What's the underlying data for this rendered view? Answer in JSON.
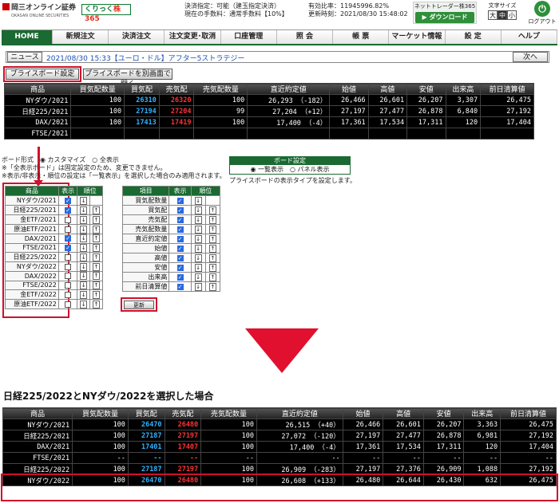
{
  "header": {
    "logo_okasan": "岡三オンライン証券",
    "logo_okasan_sub": "OKASAN ONLINE SECURITIES",
    "logo_kurikku": "くりっく",
    "logo_kabu": "株365",
    "info_left": [
      "決済指定：可能（建玉指定決済）",
      "現在の手数料：通常手数料【10%】"
    ],
    "info_right": [
      "有効比率：11945996.82%",
      "更新時刻：2021/08/30 15:48:02"
    ],
    "net_trader": "ネットトレーダー株365",
    "download_label": "ダウンロード",
    "font_size_label": "文字サイズ",
    "font_sizes": [
      "大",
      "中",
      "小"
    ],
    "logout_label": "ログアウト"
  },
  "nav": [
    "HOME",
    "新規注文",
    "決済注文",
    "注文変更･取消",
    "口座管理",
    "照 会",
    "帳 票",
    "マーケット情報",
    "設 定",
    "ヘルプ"
  ],
  "news": {
    "label": "ニュース",
    "text": "2021/08/30 15:33【ユーロ・ドル】アフター5ストラテジー",
    "next": "次へ"
  },
  "price_board_btn": "プライスボード設定",
  "price_board_open_btn": "プライスボードを別画面で開く",
  "quote_headers": [
    "商品",
    "買気配数量",
    "買気配",
    "売気配",
    "売気配数量",
    "直近約定値",
    "始値",
    "高値",
    "安値",
    "出来高",
    "前日清算値"
  ],
  "quotes_top": [
    [
      "NYダウ/2021",
      "100",
      "26310",
      "26320",
      "100",
      "26,293 （-182）",
      "26,466",
      "26,601",
      "26,207",
      "3,307",
      "26,475"
    ],
    [
      "日経225/2021",
      "100",
      "27194",
      "27204",
      "99",
      "27,204 （+12）",
      "27,197",
      "27,477",
      "26,878",
      "6,840",
      "27,192"
    ],
    [
      "DAX/2021",
      "100",
      "17413",
      "17419",
      "100",
      "17,400 （-4）",
      "17,361",
      "17,534",
      "17,311",
      "120",
      "17,404"
    ],
    [
      "FTSE/2021",
      "",
      "",
      "",
      "",
      "",
      "",
      "",
      "",
      "",
      ""
    ]
  ],
  "board_options": {
    "format_label": "ボード形式",
    "custom": "カスタマイズ",
    "all": "全表示",
    "note1": "※「全表示ボード」は固定設定のため、変更できません。",
    "note2": "※表示/非表示・順位の設定は「一覧表示」を選択した場合のみ適用されます。"
  },
  "board_setting": {
    "title": "ボード設定",
    "list": "一覧表示",
    "panel": "パネル表示",
    "note": "プライスボードの表示タイプを設定します。"
  },
  "product_table": {
    "headers": [
      "商品",
      "表示",
      "順位"
    ],
    "rows": [
      {
        "name": "NYダウ/2021",
        "on": true
      },
      {
        "name": "日経225/2021",
        "on": true
      },
      {
        "name": "金ETF/2021",
        "on": false
      },
      {
        "name": "原油ETF/2021",
        "on": false
      },
      {
        "name": "DAX/2021",
        "on": true
      },
      {
        "name": "FTSE/2021",
        "on": true
      },
      {
        "name": "日経225/2022",
        "on": false
      },
      {
        "name": "NYダウ/2022",
        "on": false
      },
      {
        "name": "DAX/2022",
        "on": false
      },
      {
        "name": "FTSE/2022",
        "on": false
      },
      {
        "name": "金ETF/2022",
        "on": false
      },
      {
        "name": "原油ETF/2022",
        "on": false
      }
    ]
  },
  "item_table": {
    "headers": [
      "項目",
      "表示",
      "順位"
    ],
    "rows": [
      {
        "name": "買気配数量",
        "on": true
      },
      {
        "name": "買気配",
        "on": true
      },
      {
        "name": "売気配",
        "on": true
      },
      {
        "name": "売気配数量",
        "on": true
      },
      {
        "name": "直近約定値",
        "on": true
      },
      {
        "name": "始値",
        "on": true
      },
      {
        "name": "高値",
        "on": true
      },
      {
        "name": "安値",
        "on": true
      },
      {
        "name": "出来高",
        "on": true
      },
      {
        "name": "前日清算値",
        "on": true
      }
    ]
  },
  "update_btn": "更新",
  "arrow_down": "↓",
  "arrow_up": "↑",
  "caption": "日経225/2022とNYダウ/2022を選択した場合",
  "quotes_bottom": [
    [
      "NYダウ/2021",
      "100",
      "26470",
      "26480",
      "100",
      "26,515 （+40）",
      "26,466",
      "26,601",
      "26,207",
      "3,363",
      "26,475"
    ],
    [
      "日経225/2021",
      "100",
      "27187",
      "27197",
      "100",
      "27,072 （-120）",
      "27,197",
      "27,477",
      "26,878",
      "6,981",
      "27,192"
    ],
    [
      "DAX/2021",
      "100",
      "17401",
      "17407",
      "100",
      "17,400 （-4）",
      "17,361",
      "17,534",
      "17,311",
      "120",
      "17,404"
    ],
    [
      "FTSE/2021",
      "--",
      "--",
      "--",
      "--",
      "--",
      "--",
      "--",
      "--",
      "--",
      "--"
    ],
    [
      "日経225/2022",
      "100",
      "27187",
      "27197",
      "100",
      "26,909 （-283）",
      "27,197",
      "27,376",
      "26,909",
      "1,088",
      "27,192"
    ],
    [
      "NYダウ/2022",
      "100",
      "26470",
      "26480",
      "100",
      "26,608 （+133）",
      "26,480",
      "26,644",
      "26,430",
      "632",
      "26,475"
    ]
  ],
  "colors": {
    "brand_green": "#1a6a32",
    "highlight_red": "#d0102b",
    "bid_blue": "#2fb3ff",
    "ask_red": "#ff3333"
  }
}
